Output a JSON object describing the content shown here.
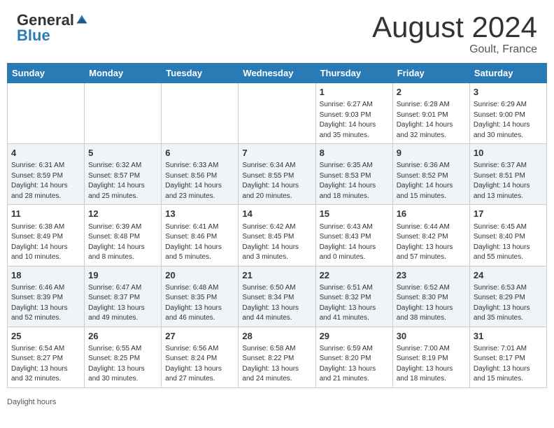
{
  "header": {
    "logo_general": "General",
    "logo_blue": "Blue",
    "month_title": "August 2024",
    "location": "Goult, France"
  },
  "weekdays": [
    "Sunday",
    "Monday",
    "Tuesday",
    "Wednesday",
    "Thursday",
    "Friday",
    "Saturday"
  ],
  "weeks": [
    [
      {
        "day": "",
        "info": ""
      },
      {
        "day": "",
        "info": ""
      },
      {
        "day": "",
        "info": ""
      },
      {
        "day": "",
        "info": ""
      },
      {
        "day": "1",
        "info": "Sunrise: 6:27 AM\nSunset: 9:03 PM\nDaylight: 14 hours and 35 minutes."
      },
      {
        "day": "2",
        "info": "Sunrise: 6:28 AM\nSunset: 9:01 PM\nDaylight: 14 hours and 32 minutes."
      },
      {
        "day": "3",
        "info": "Sunrise: 6:29 AM\nSunset: 9:00 PM\nDaylight: 14 hours and 30 minutes."
      }
    ],
    [
      {
        "day": "4",
        "info": "Sunrise: 6:31 AM\nSunset: 8:59 PM\nDaylight: 14 hours and 28 minutes."
      },
      {
        "day": "5",
        "info": "Sunrise: 6:32 AM\nSunset: 8:57 PM\nDaylight: 14 hours and 25 minutes."
      },
      {
        "day": "6",
        "info": "Sunrise: 6:33 AM\nSunset: 8:56 PM\nDaylight: 14 hours and 23 minutes."
      },
      {
        "day": "7",
        "info": "Sunrise: 6:34 AM\nSunset: 8:55 PM\nDaylight: 14 hours and 20 minutes."
      },
      {
        "day": "8",
        "info": "Sunrise: 6:35 AM\nSunset: 8:53 PM\nDaylight: 14 hours and 18 minutes."
      },
      {
        "day": "9",
        "info": "Sunrise: 6:36 AM\nSunset: 8:52 PM\nDaylight: 14 hours and 15 minutes."
      },
      {
        "day": "10",
        "info": "Sunrise: 6:37 AM\nSunset: 8:51 PM\nDaylight: 14 hours and 13 minutes."
      }
    ],
    [
      {
        "day": "11",
        "info": "Sunrise: 6:38 AM\nSunset: 8:49 PM\nDaylight: 14 hours and 10 minutes."
      },
      {
        "day": "12",
        "info": "Sunrise: 6:39 AM\nSunset: 8:48 PM\nDaylight: 14 hours and 8 minutes."
      },
      {
        "day": "13",
        "info": "Sunrise: 6:41 AM\nSunset: 8:46 PM\nDaylight: 14 hours and 5 minutes."
      },
      {
        "day": "14",
        "info": "Sunrise: 6:42 AM\nSunset: 8:45 PM\nDaylight: 14 hours and 3 minutes."
      },
      {
        "day": "15",
        "info": "Sunrise: 6:43 AM\nSunset: 8:43 PM\nDaylight: 14 hours and 0 minutes."
      },
      {
        "day": "16",
        "info": "Sunrise: 6:44 AM\nSunset: 8:42 PM\nDaylight: 13 hours and 57 minutes."
      },
      {
        "day": "17",
        "info": "Sunrise: 6:45 AM\nSunset: 8:40 PM\nDaylight: 13 hours and 55 minutes."
      }
    ],
    [
      {
        "day": "18",
        "info": "Sunrise: 6:46 AM\nSunset: 8:39 PM\nDaylight: 13 hours and 52 minutes."
      },
      {
        "day": "19",
        "info": "Sunrise: 6:47 AM\nSunset: 8:37 PM\nDaylight: 13 hours and 49 minutes."
      },
      {
        "day": "20",
        "info": "Sunrise: 6:48 AM\nSunset: 8:35 PM\nDaylight: 13 hours and 46 minutes."
      },
      {
        "day": "21",
        "info": "Sunrise: 6:50 AM\nSunset: 8:34 PM\nDaylight: 13 hours and 44 minutes."
      },
      {
        "day": "22",
        "info": "Sunrise: 6:51 AM\nSunset: 8:32 PM\nDaylight: 13 hours and 41 minutes."
      },
      {
        "day": "23",
        "info": "Sunrise: 6:52 AM\nSunset: 8:30 PM\nDaylight: 13 hours and 38 minutes."
      },
      {
        "day": "24",
        "info": "Sunrise: 6:53 AM\nSunset: 8:29 PM\nDaylight: 13 hours and 35 minutes."
      }
    ],
    [
      {
        "day": "25",
        "info": "Sunrise: 6:54 AM\nSunset: 8:27 PM\nDaylight: 13 hours and 32 minutes."
      },
      {
        "day": "26",
        "info": "Sunrise: 6:55 AM\nSunset: 8:25 PM\nDaylight: 13 hours and 30 minutes."
      },
      {
        "day": "27",
        "info": "Sunrise: 6:56 AM\nSunset: 8:24 PM\nDaylight: 13 hours and 27 minutes."
      },
      {
        "day": "28",
        "info": "Sunrise: 6:58 AM\nSunset: 8:22 PM\nDaylight: 13 hours and 24 minutes."
      },
      {
        "day": "29",
        "info": "Sunrise: 6:59 AM\nSunset: 8:20 PM\nDaylight: 13 hours and 21 minutes."
      },
      {
        "day": "30",
        "info": "Sunrise: 7:00 AM\nSunset: 8:19 PM\nDaylight: 13 hours and 18 minutes."
      },
      {
        "day": "31",
        "info": "Sunrise: 7:01 AM\nSunset: 8:17 PM\nDaylight: 13 hours and 15 minutes."
      }
    ]
  ],
  "footer": {
    "daylight_label": "Daylight hours"
  }
}
